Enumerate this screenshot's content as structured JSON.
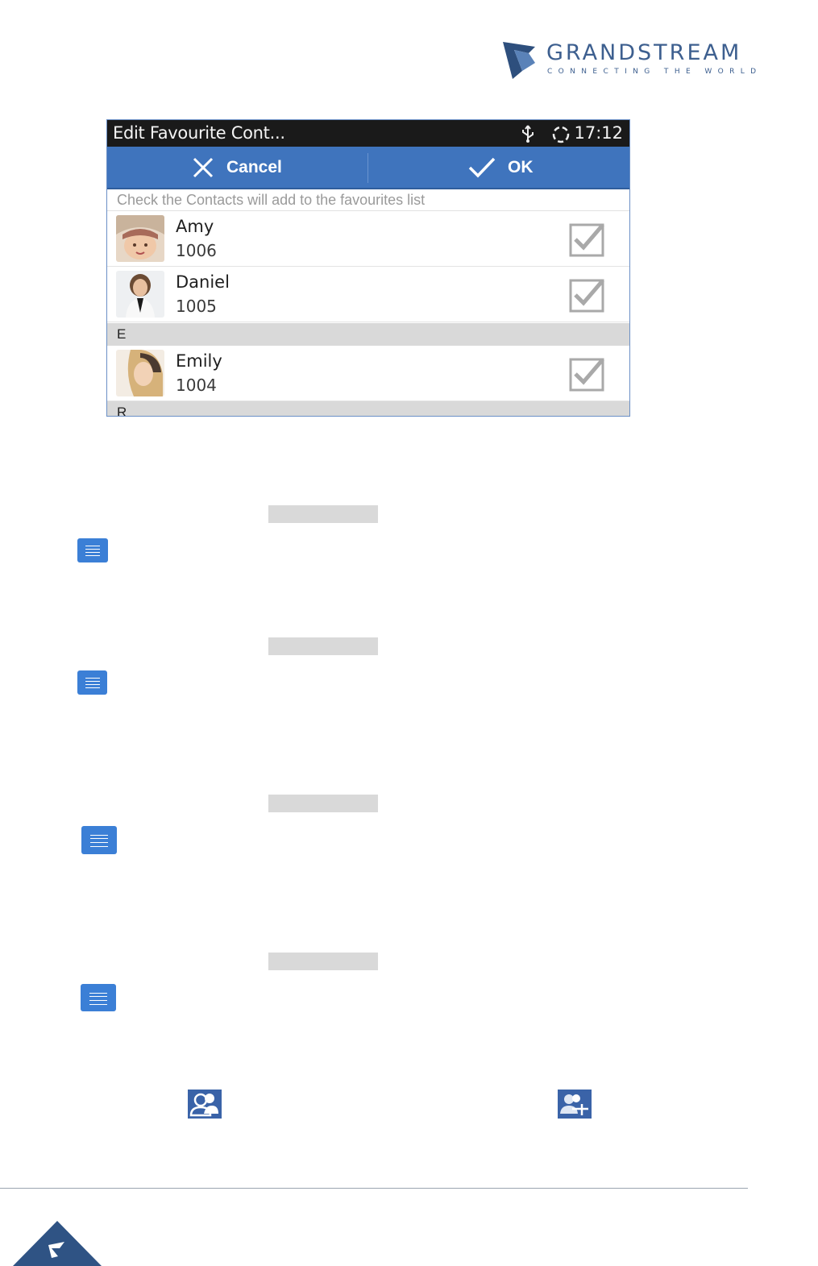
{
  "logo": {
    "brand": "GRANDSTREAM",
    "tagline": "CONNECTING THE WORLD",
    "color": "#3d5f8f"
  },
  "screen": {
    "status_bar": {
      "title": "Edit Favourite Cont...",
      "time": "17:12",
      "icons": [
        "usb-icon",
        "sync-icon"
      ]
    },
    "action_bar": {
      "cancel_label": "Cancel",
      "ok_label": "OK",
      "color": "#3f74bd"
    },
    "hint": "Check the Contacts will add to the favourites list",
    "contacts": [
      {
        "name": "Amy",
        "number": "1006",
        "checked": true
      },
      {
        "name": "Daniel",
        "number": "1005",
        "checked": true
      }
    ],
    "section_e": "E",
    "contacts_e": [
      {
        "name": "Emily",
        "number": "1004",
        "checked": true
      }
    ],
    "section_next": "R"
  },
  "body_icons": [
    "menu-icon",
    "menu-icon",
    "menu-icon",
    "menu-icon",
    "contacts-icon",
    "add-contact-icon"
  ]
}
